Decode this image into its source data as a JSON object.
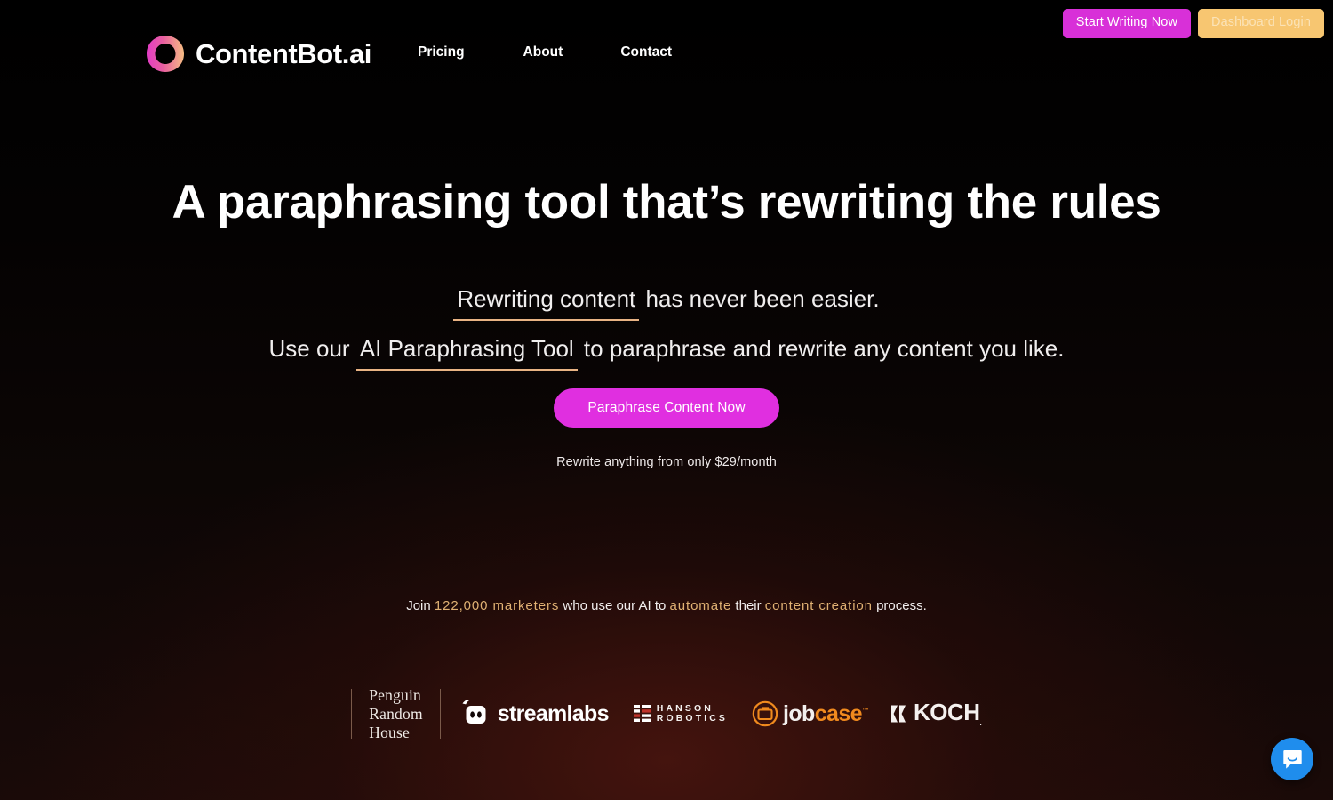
{
  "brand": {
    "name": "ContentBot.ai",
    "logo_icon": "contentbot-ring-icon",
    "gradient_from": "#e040c0",
    "gradient_to": "#f6b882"
  },
  "nav": {
    "items": [
      {
        "label": "Pricing"
      },
      {
        "label": "About"
      },
      {
        "label": "Contact"
      }
    ]
  },
  "header_buttons": {
    "start_writing": "Start Writing Now",
    "start_writing_bg": "#d830d8",
    "dashboard_login": "Dashboard Login",
    "dashboard_login_bg": "#f7c671"
  },
  "hero": {
    "headline": "A paraphrasing tool that’s rewriting the rules",
    "sub1_highlight": "Rewriting content",
    "sub1_rest": " has never been easier.",
    "sub2_before": "Use our ",
    "sub2_highlight": "AI Paraphrasing Tool",
    "sub2_after": " to paraphrase and rewrite any content you like.",
    "underline_color": "#e8b384",
    "cta_label": "Paraphrase Content Now",
    "cta_bg": "#e02fe0",
    "price_note": "Rewrite anything from only $29/month"
  },
  "social_proof": {
    "join_word": "Join ",
    "count": "122,000 marketers",
    "mid1": " who use our AI to ",
    "automate": "automate",
    "mid2": " their ",
    "content_creation": "content creation",
    "tail": " process.",
    "accent_color": "#e0b173"
  },
  "logos": [
    {
      "name": "Penguin Random House",
      "lines": [
        "Penguin",
        "Random",
        "House"
      ]
    },
    {
      "name": "streamlabs",
      "wordmark": "streamlabs"
    },
    {
      "name": "Hanson Robotics",
      "lines": [
        "HANSON",
        "ROBOTICS"
      ],
      "accent": "#c0332b"
    },
    {
      "name": "jobcase",
      "part1": "job",
      "part2": "case",
      "tm": "™",
      "accent": "#f08a1e"
    },
    {
      "name": "KOCH",
      "wordmark": "KOCH",
      "tm": "."
    }
  ],
  "chat": {
    "icon": "chat-bubble-icon",
    "bg": "#1f8ded"
  }
}
